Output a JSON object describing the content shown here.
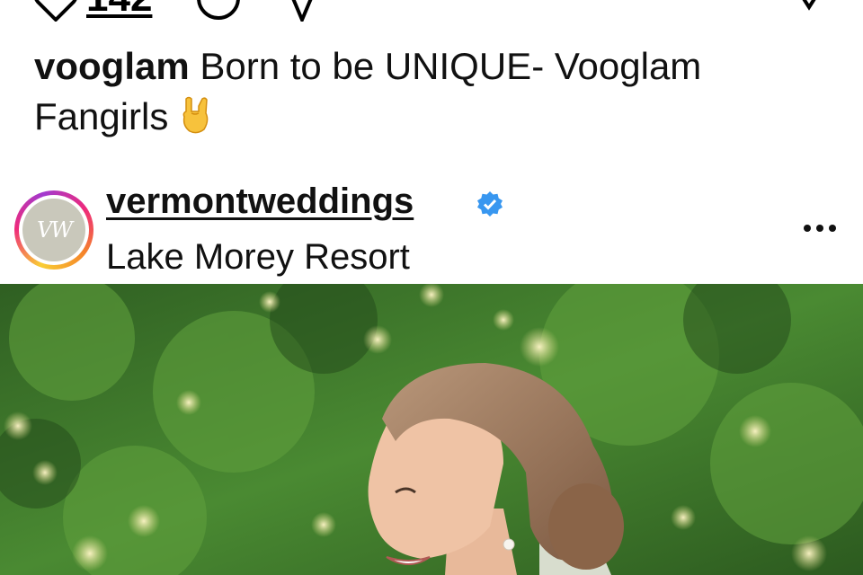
{
  "post": {
    "like_count": "142",
    "caption_user": "vooglam",
    "caption_text": "Born to be UNIQUE- Vooglam Fangirls",
    "caption_emoji": "rock-on-hand-emoji"
  },
  "next_post": {
    "username": "vermontweddings",
    "verified": true,
    "location": "Lake Morey Resort",
    "avatar_monogram": "VW",
    "photo_subject": "bride smiling outdoors with greenery background"
  },
  "icons": [
    "heart-icon",
    "comment-icon",
    "share-icon",
    "bookmark-icon",
    "verified-badge-icon",
    "more-options-icon"
  ],
  "colors": {
    "verified": "#3897f0",
    "text": "#111111",
    "foliage": "#3f7a2c"
  }
}
